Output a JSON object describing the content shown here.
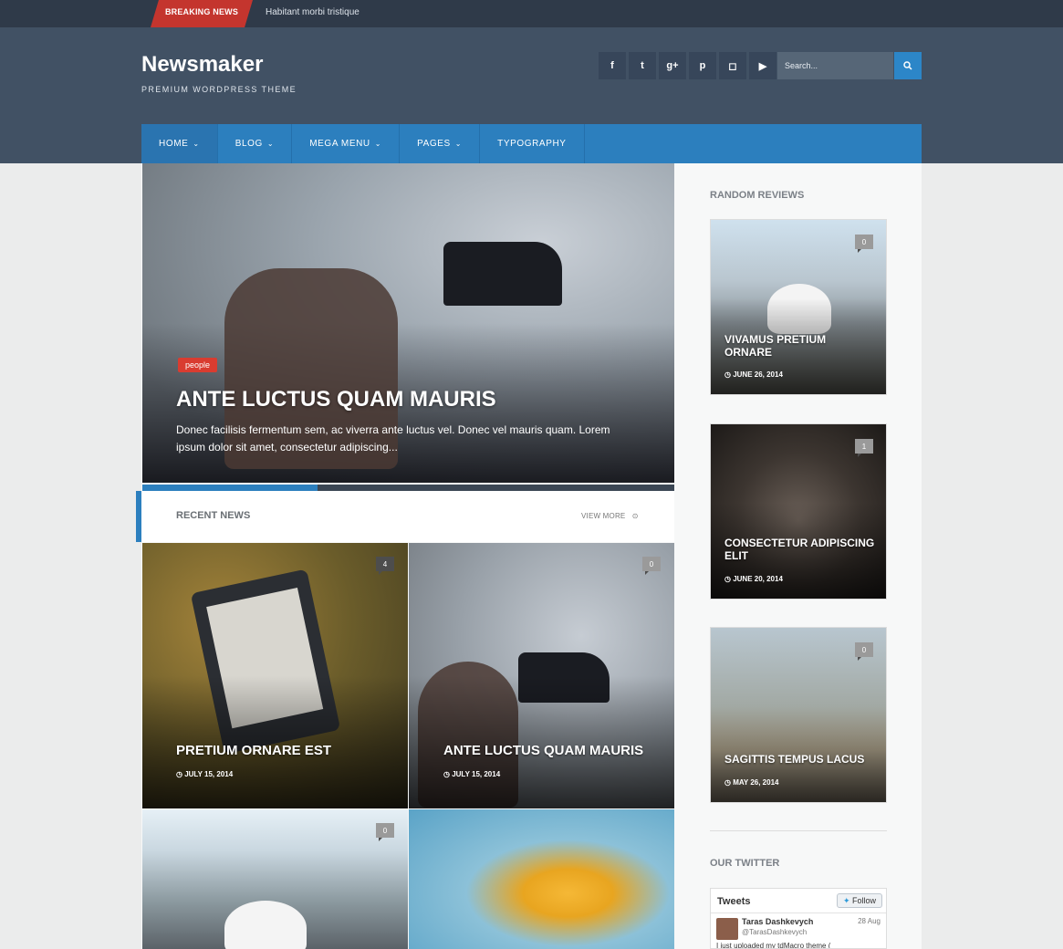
{
  "breaking": {
    "label": "BREAKING NEWS",
    "text": "Habitant morbi tristique"
  },
  "site": {
    "title": "Newsmaker",
    "tagline": "PREMIUM WORDPRESS THEME"
  },
  "socials": [
    {
      "icon": "facebook-icon",
      "glyph": "f"
    },
    {
      "icon": "twitter-icon",
      "glyph": "t"
    },
    {
      "icon": "google-plus-icon",
      "glyph": "g+"
    },
    {
      "icon": "pinterest-icon",
      "glyph": "p"
    },
    {
      "icon": "instagram-icon",
      "glyph": "◻"
    },
    {
      "icon": "youtube-icon",
      "glyph": "▶"
    }
  ],
  "search": {
    "placeholder": "Search..."
  },
  "nav": {
    "items": [
      {
        "label": "HOME",
        "has_dropdown": true
      },
      {
        "label": "BLOG",
        "has_dropdown": true
      },
      {
        "label": "MEGA MENU",
        "has_dropdown": true
      },
      {
        "label": "PAGES",
        "has_dropdown": true
      },
      {
        "label": "TYPOGRAPHY",
        "has_dropdown": false
      }
    ]
  },
  "hero": {
    "tag": "people",
    "title": "ANTE LUCTUS QUAM MAURIS",
    "description": "Donec facilisis fermentum sem, ac viverra ante luctus vel. Donec vel mauris quam. Lorem ipsum dolor sit amet, consectetur adipiscing...",
    "slider_progress": 0.33
  },
  "recent": {
    "title": "RECENT NEWS",
    "view_more": "VIEW MORE",
    "cards": [
      {
        "title": "PRETIUM ORNARE EST",
        "date": "JULY 15, 2014",
        "comments": "4"
      },
      {
        "title": "ANTE LUCTUS QUAM MAURIS",
        "date": "JULY 15, 2014",
        "comments": "0"
      },
      {
        "title": "",
        "date": "",
        "comments": "0"
      },
      {
        "title": "",
        "date": "",
        "comments": ""
      }
    ]
  },
  "sidebar": {
    "reviews_title": "RANDOM REVIEWS",
    "reviews": [
      {
        "title": "VIVAMUS PRETIUM ORNARE",
        "date": "JUNE 26, 2014",
        "comments": "0"
      },
      {
        "title": "CONSECTETUR ADIPISCING ELIT",
        "date": "JUNE 20, 2014",
        "comments": "1"
      },
      {
        "title": "SAGITTIS TEMPUS LACUS",
        "date": "MAY 26, 2014",
        "comments": "0"
      }
    ],
    "twitter_title": "OUR TWITTER",
    "twitter": {
      "header": "Tweets",
      "follow": "Follow",
      "name": "Taras Dashkevych",
      "handle": "@TarasDashkevych",
      "date": "28 Aug",
      "text": "I just uploaded my tdMacro theme ("
    }
  },
  "colors": {
    "accent": "#2c7fbe",
    "breaking": "#c4352e",
    "header": "#415164",
    "topbar": "#2f3a49"
  }
}
